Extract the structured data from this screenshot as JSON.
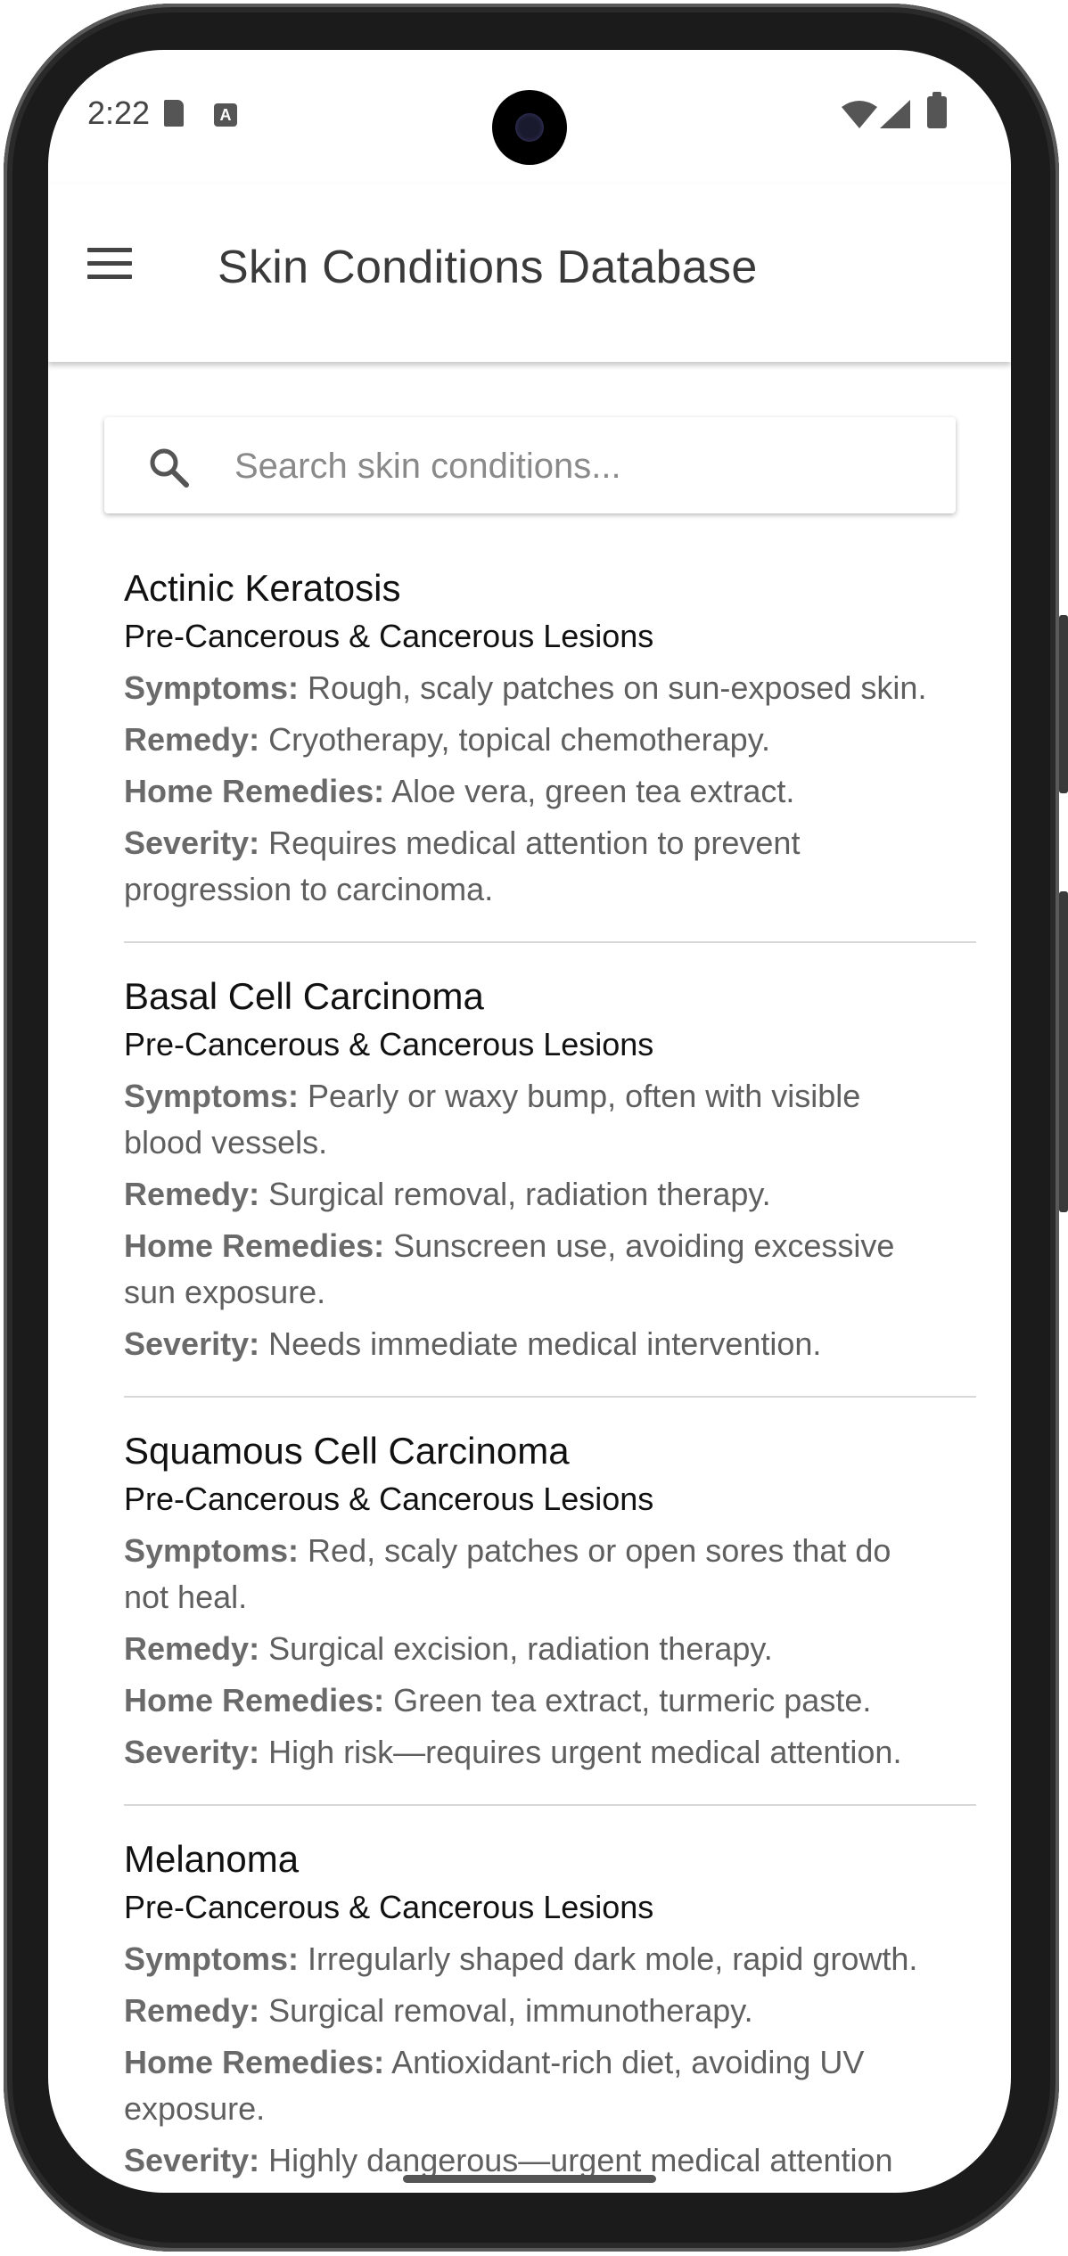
{
  "status_bar": {
    "time": "2:22",
    "a_badge": "A",
    "icons": [
      "sd-card-icon",
      "a-notification-icon",
      "wifi-icon",
      "signal-icon",
      "battery-icon"
    ]
  },
  "app_bar": {
    "title": "Skin Conditions Database",
    "menu_icon": "menu-icon"
  },
  "search": {
    "placeholder": "Search skin conditions...",
    "value": "",
    "icon": "search-icon"
  },
  "labels": {
    "symptoms": "Symptoms:",
    "remedy": "Remedy:",
    "home_remedies": "Home Remedies:",
    "severity": "Severity:"
  },
  "conditions": [
    {
      "name": "Actinic Keratosis",
      "category": "Pre-Cancerous & Cancerous Lesions",
      "symptoms": "Rough, scaly patches on sun-exposed skin.",
      "remedy": "Cryotherapy, topical chemotherapy.",
      "home_remedies": "Aloe vera, green tea extract.",
      "severity": "Requires medical attention to prevent progression to carcinoma."
    },
    {
      "name": "Basal Cell Carcinoma",
      "category": "Pre-Cancerous & Cancerous Lesions",
      "symptoms": "Pearly or waxy bump, often with visible blood vessels.",
      "remedy": "Surgical removal, radiation therapy.",
      "home_remedies": "Sunscreen use, avoiding excessive sun exposure.",
      "severity": "Needs immediate medical intervention."
    },
    {
      "name": "Squamous Cell Carcinoma",
      "category": "Pre-Cancerous & Cancerous Lesions",
      "symptoms": "Red, scaly patches or open sores that do not heal.",
      "remedy": "Surgical excision, radiation therapy.",
      "home_remedies": "Green tea extract, turmeric paste.",
      "severity": "High risk—requires urgent medical attention."
    },
    {
      "name": "Melanoma",
      "category": "Pre-Cancerous & Cancerous Lesions",
      "symptoms": "Irregularly shaped dark mole, rapid growth.",
      "remedy": "Surgical removal, immunotherapy.",
      "home_remedies": "Antioxidant-rich diet, avoiding UV exposure.",
      "severity": "Highly dangerous—urgent medical attention required."
    }
  ]
}
